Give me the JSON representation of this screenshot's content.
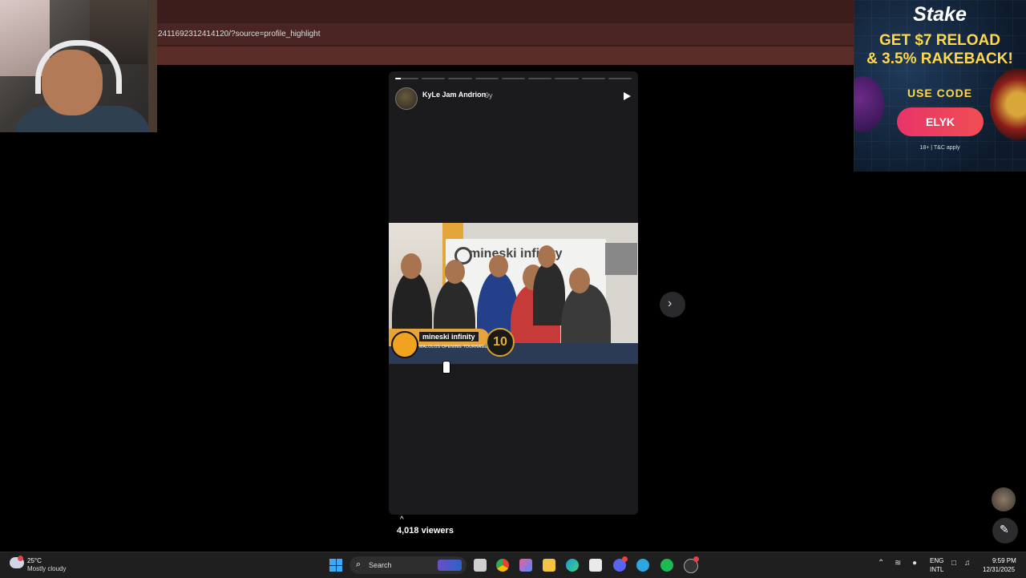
{
  "browser": {
    "url_fragment": "2411692312414120/?source=profile_highlight"
  },
  "story": {
    "author": "KyLe Jam Andrion",
    "age": "9y",
    "segments": [
      {
        "progress": 0.25
      },
      {
        "progress": 0
      },
      {
        "progress": 0
      },
      {
        "progress": 0
      },
      {
        "progress": 0
      },
      {
        "progress": 0
      },
      {
        "progress": 0
      },
      {
        "progress": 0
      },
      {
        "progress": 0
      }
    ],
    "photo": {
      "banner_brand": "mineski infinity",
      "logo_text": "mineski infinity",
      "logo_subtitle": "MALOLOS OPENING TOURNAMENT",
      "badge": "10"
    },
    "viewers_chevron": "^",
    "viewers": "4,018 viewers"
  },
  "ad": {
    "brand": "Stake",
    "headline1": "GET $7 RELOAD",
    "headline2": "& 3.5% RAKEBACK!",
    "use_code": "USE CODE",
    "code": "ELYK",
    "terms": "18+ | T&C apply"
  },
  "taskbar": {
    "temperature": "25°C",
    "condition": "Mostly cloudy",
    "search_placeholder": "Search",
    "lang_line1": "ENG",
    "lang_line2": "INTL",
    "time": "9:59 PM",
    "date": "12/31/2025",
    "colors": {
      "windows": "#3fa9f5",
      "chrome": "#e8b13a",
      "folder": "#f4c542",
      "edge": "#1c9bd8",
      "discord": "#5865f2",
      "telegram": "#2ea6df",
      "spotify": "#1db954"
    }
  }
}
